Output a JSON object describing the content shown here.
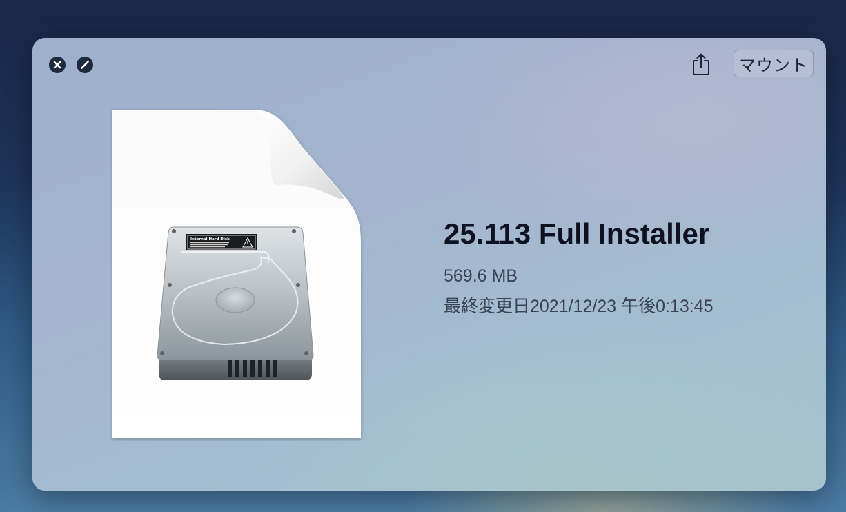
{
  "window": {
    "controls": {
      "close_icon": "close-icon",
      "fullscreen_icon": "fullscreen-icon"
    },
    "toolbar": {
      "share_icon": "share-icon",
      "mount_label": "マウント"
    }
  },
  "file": {
    "icon": "disk-image-document-icon",
    "disk_label": "Internal Hard Disk",
    "name": "25.113 Full Installer",
    "size": "569.6 MB",
    "modified": "最終変更日2021/12/23 午後0:13:45"
  },
  "colors": {
    "panel": "#a3b5cf",
    "text_primary": "#0e1220",
    "text_secondary": "#3a4356",
    "control": "#1e2a3d"
  }
}
